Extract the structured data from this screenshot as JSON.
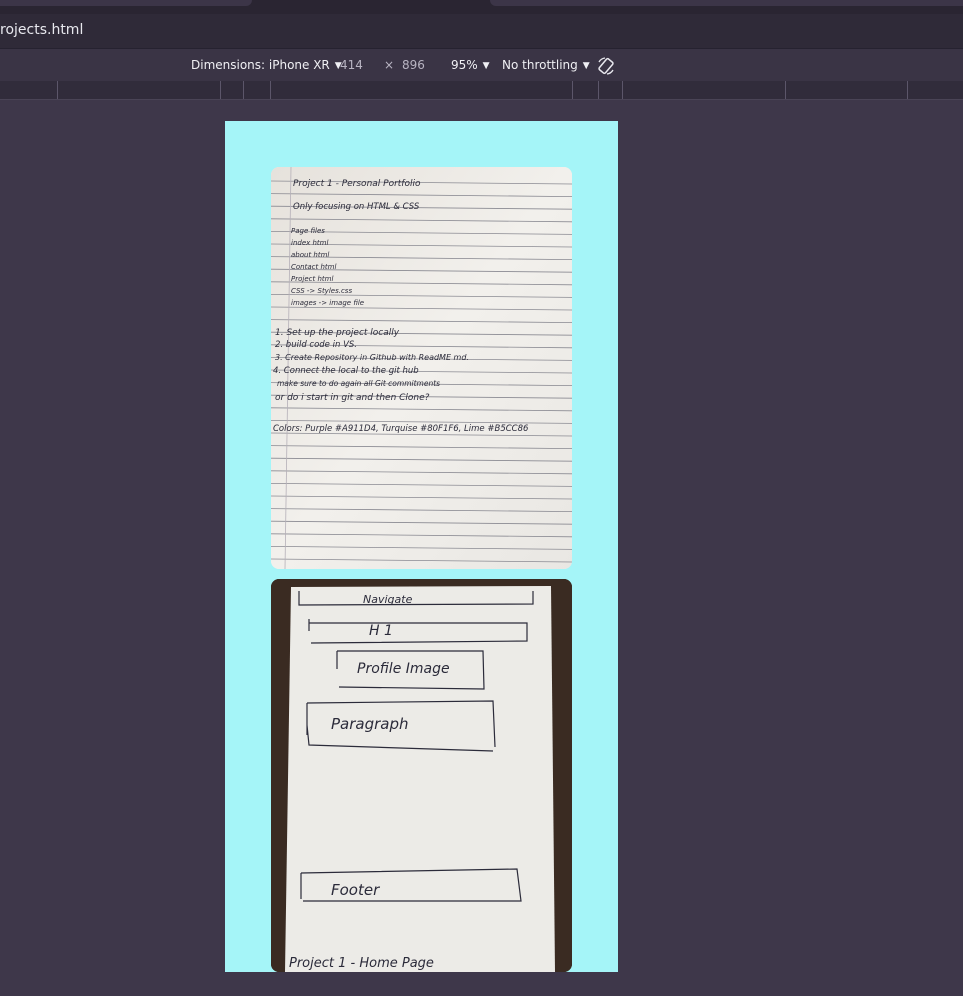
{
  "browser": {
    "url_fragment": "rojects.html"
  },
  "device_toolbar": {
    "dimensions_label": "Dimensions: iPhone XR",
    "width": "414",
    "times": "×",
    "height": "896",
    "zoom": "95%",
    "throttling": "No throttling",
    "rotate_icon": "rotate-icon"
  },
  "sketches": {
    "notes": {
      "lines": [
        "Project 1 - Personal Portfolio",
        "Only focusing on HTML & CSS",
        "Page files",
        "index html",
        "about html",
        "Contact html",
        "Project html",
        "CSS -> Styles.css",
        "images -> image file",
        "1. Set up the project locally",
        "2. build code in VS.",
        "3. Create Repository in Github with ReadME md.",
        "4. Connect the local to the git hub",
        "make sure to do again all Git commitments",
        "or do i start in git and then Clone?",
        "Colors: Purple #A911D4, Turquise #80F1F6, Lime #B5CC86"
      ]
    },
    "wireframe": {
      "nav": "Navigate",
      "h1": "H 1",
      "profile": "Profile Image",
      "paragraph": "Paragraph",
      "footer": "Footer",
      "caption": "Project 1 - Home Page"
    }
  },
  "colors": {
    "page_bg": "#3e374a",
    "device_bg": "#a5f5f8"
  }
}
